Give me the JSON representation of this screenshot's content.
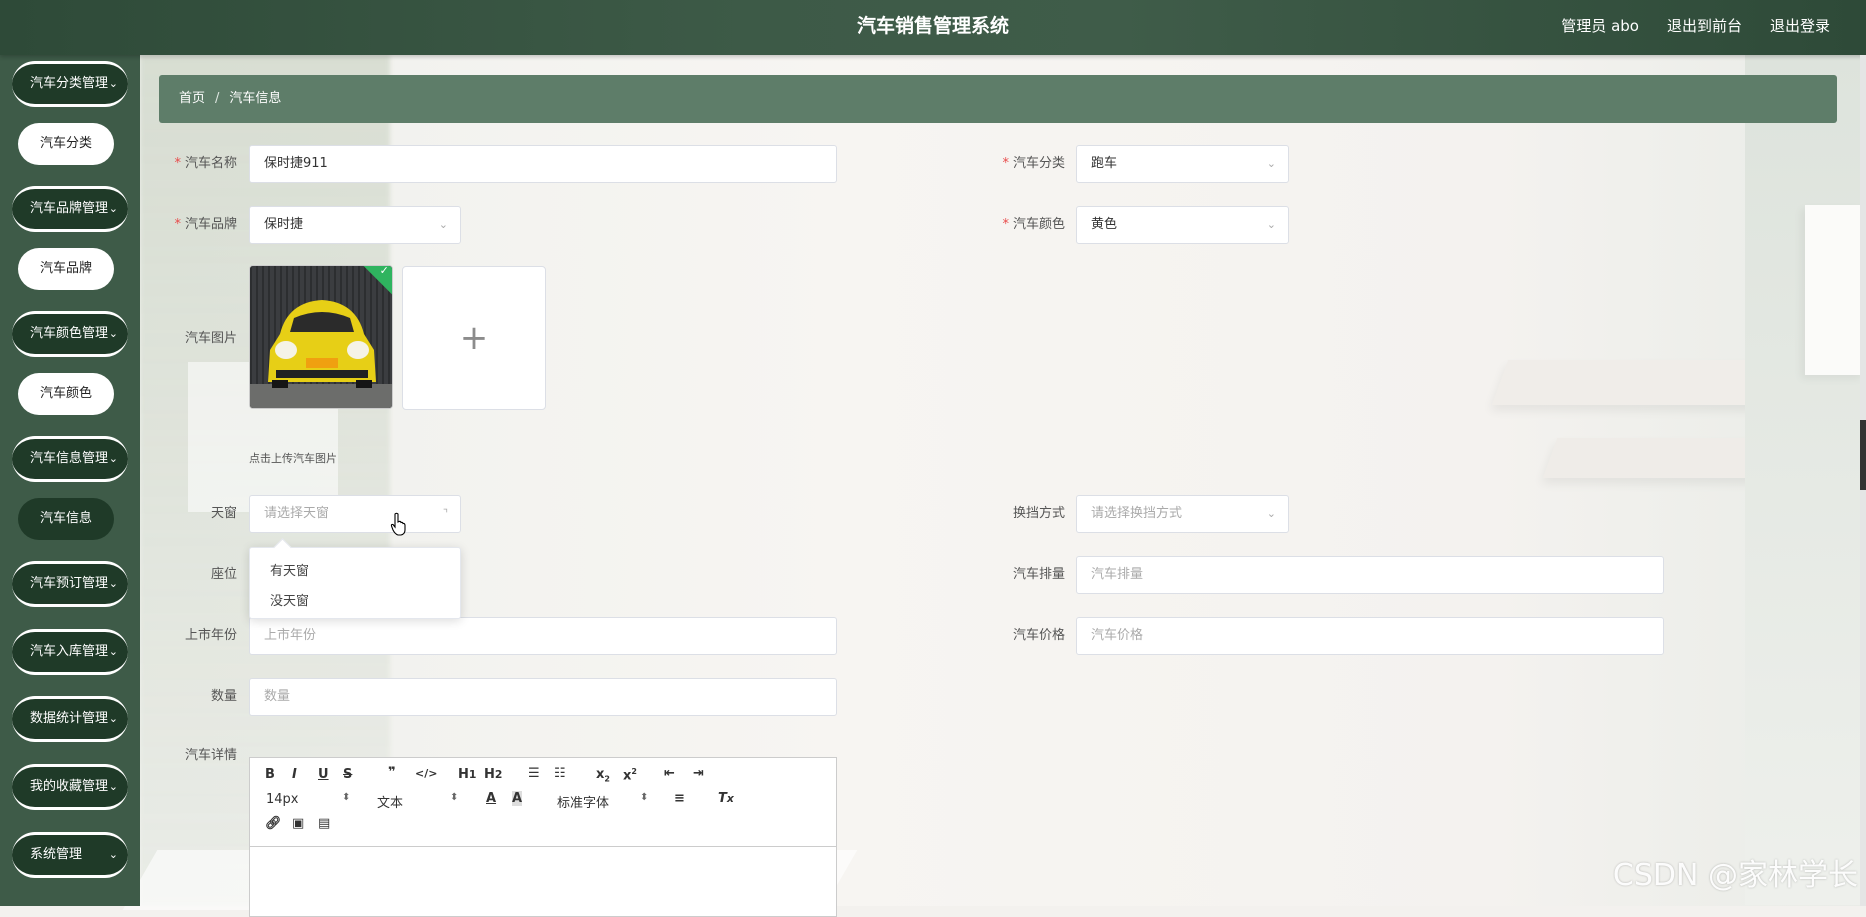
{
  "header": {
    "title": "汽车销售管理系统",
    "user": "管理员 abo",
    "to_front": "退出到前台",
    "logout": "退出登录"
  },
  "sidebar": {
    "groups": [
      {
        "label": "汽车分类管理",
        "sub": "汽车分类"
      },
      {
        "label": "汽车品牌管理",
        "sub": "汽车品牌"
      },
      {
        "label": "汽车颜色管理",
        "sub": "汽车颜色"
      },
      {
        "label": "汽车信息管理",
        "sub": "汽车信息"
      },
      {
        "label": "汽车预订管理"
      },
      {
        "label": "汽车入库管理"
      },
      {
        "label": "数据统计管理"
      },
      {
        "label": "我的收藏管理"
      },
      {
        "label": "系统管理"
      }
    ],
    "active_sub": "汽车信息"
  },
  "breadcrumb": {
    "home": "首页",
    "sep": "/",
    "current": "汽车信息"
  },
  "form": {
    "name": {
      "label": "汽车名称",
      "value": "保时捷911"
    },
    "category": {
      "label": "汽车分类",
      "value": "跑车"
    },
    "brand": {
      "label": "汽车品牌",
      "value": "保时捷"
    },
    "color": {
      "label": "汽车颜色",
      "value": "黄色"
    },
    "image": {
      "label": "汽车图片",
      "hint": "点击上传汽车图片"
    },
    "sunroof": {
      "label": "天窗",
      "placeholder": "请选择天窗",
      "options": [
        "有天窗",
        "没天窗"
      ]
    },
    "gearbox": {
      "label": "换挡方式",
      "placeholder": "请选择换挡方式"
    },
    "seats": {
      "label": "座位"
    },
    "displacement": {
      "label": "汽车排量",
      "placeholder": "汽车排量"
    },
    "year": {
      "label": "上市年份",
      "placeholder": "上市年份"
    },
    "price": {
      "label": "汽车价格",
      "placeholder": "汽车价格"
    },
    "quantity": {
      "label": "数量",
      "placeholder": "数量"
    },
    "detail": {
      "label": "汽车详情"
    }
  },
  "editor": {
    "font_size": "14px",
    "block_type": "文本",
    "font_family": "标准字体"
  },
  "watermark": "CSDN @家林学长",
  "colors": {
    "header": "#3d5a47",
    "sidebar": "#3e5b48",
    "menu_button": "#1f3a28",
    "breadcrumb_bar": "#5e7d69",
    "required": "#e84a4a"
  }
}
